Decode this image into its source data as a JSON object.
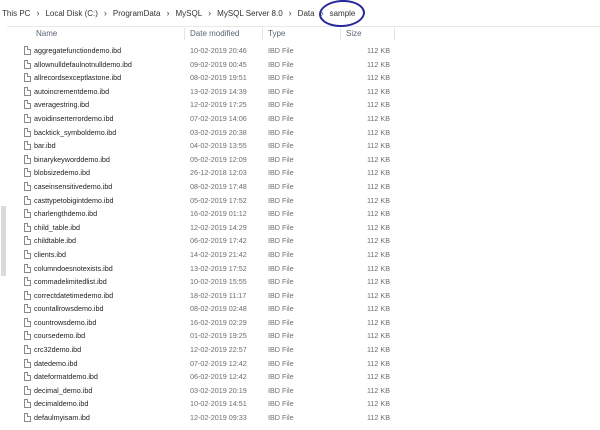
{
  "breadcrumb": [
    "This PC",
    "Local Disk (C:)",
    "ProgramData",
    "MySQL",
    "MySQL Server 8.0",
    "Data",
    "sample"
  ],
  "breadcrumb_separator": "›",
  "highlight_color": "#26279a",
  "columns": {
    "name": "Name",
    "date": "Date modified",
    "type": "Type",
    "size": "Size"
  },
  "files": [
    {
      "name": "aggregatefunctiondemo.ibd",
      "date": "10-02-2019 20:46",
      "type": "IBD File",
      "size": "112 KB"
    },
    {
      "name": "allownulldefaulnotnulldemo.ibd",
      "date": "09-02-2019 00:45",
      "type": "IBD File",
      "size": "112 KB"
    },
    {
      "name": "allrecordsexceptlastone.ibd",
      "date": "08-02-2019 19:51",
      "type": "IBD File",
      "size": "112 KB"
    },
    {
      "name": "autoincrementdemo.ibd",
      "date": "13-02-2019 14:39",
      "type": "IBD File",
      "size": "112 KB"
    },
    {
      "name": "averagestring.ibd",
      "date": "12-02-2019 17:25",
      "type": "IBD File",
      "size": "112 KB"
    },
    {
      "name": "avoidinserterrordemo.ibd",
      "date": "07-02-2019 14:06",
      "type": "IBD File",
      "size": "112 KB"
    },
    {
      "name": "backtick_symboldemo.ibd",
      "date": "03-02-2019 20:38",
      "type": "IBD File",
      "size": "112 KB"
    },
    {
      "name": "bar.ibd",
      "date": "04-02-2019 13:55",
      "type": "IBD File",
      "size": "112 KB"
    },
    {
      "name": "binarykeyworddemo.ibd",
      "date": "05-02-2019 12:09",
      "type": "IBD File",
      "size": "112 KB"
    },
    {
      "name": "blobsizedemo.ibd",
      "date": "26-12-2018 12:03",
      "type": "IBD File",
      "size": "112 KB"
    },
    {
      "name": "caseinsensitivedemo.ibd",
      "date": "08-02-2019 17:48",
      "type": "IBD File",
      "size": "112 KB"
    },
    {
      "name": "casttypetobigintdemo.ibd",
      "date": "05-02-2019 17:52",
      "type": "IBD File",
      "size": "112 KB"
    },
    {
      "name": "charlengthdemo.ibd",
      "date": "16-02-2019 01:12",
      "type": "IBD File",
      "size": "112 KB"
    },
    {
      "name": "child_table.ibd",
      "date": "12-02-2019 14:29",
      "type": "IBD File",
      "size": "112 KB"
    },
    {
      "name": "childtable.ibd",
      "date": "06-02-2019 17:42",
      "type": "IBD File",
      "size": "112 KB"
    },
    {
      "name": "clients.ibd",
      "date": "14-02-2019 21:42",
      "type": "IBD File",
      "size": "112 KB"
    },
    {
      "name": "columndoesnotexists.ibd",
      "date": "13-02-2019 17:52",
      "type": "IBD File",
      "size": "112 KB"
    },
    {
      "name": "commadelimitedlist.ibd",
      "date": "10-02-2019 15:55",
      "type": "IBD File",
      "size": "112 KB"
    },
    {
      "name": "correctdatetimedemo.ibd",
      "date": "18-02-2019 11:17",
      "type": "IBD File",
      "size": "112 KB"
    },
    {
      "name": "countallrowsdemo.ibd",
      "date": "08-02-2019 02:48",
      "type": "IBD File",
      "size": "112 KB"
    },
    {
      "name": "countrowsdemo.ibd",
      "date": "16-02-2019 02:29",
      "type": "IBD File",
      "size": "112 KB"
    },
    {
      "name": "coursedemo.ibd",
      "date": "01-02-2019 19:25",
      "type": "IBD File",
      "size": "112 KB"
    },
    {
      "name": "crc32demo.ibd",
      "date": "12-02-2019 22:57",
      "type": "IBD File",
      "size": "112 KB"
    },
    {
      "name": "datedemo.ibd",
      "date": "07-02-2019 12:42",
      "type": "IBD File",
      "size": "112 KB"
    },
    {
      "name": "dateformatdemo.ibd",
      "date": "06-02-2019 12:42",
      "type": "IBD File",
      "size": "112 KB"
    },
    {
      "name": "decimal_demo.ibd",
      "date": "03-02-2019 20:19",
      "type": "IBD File",
      "size": "112 KB"
    },
    {
      "name": "decimaldemo.ibd",
      "date": "10-02-2019 14:51",
      "type": "IBD File",
      "size": "112 KB"
    },
    {
      "name": "defaulmyisam.ibd",
      "date": "12-02-2019 09:33",
      "type": "IBD File",
      "size": "112 KB"
    }
  ]
}
